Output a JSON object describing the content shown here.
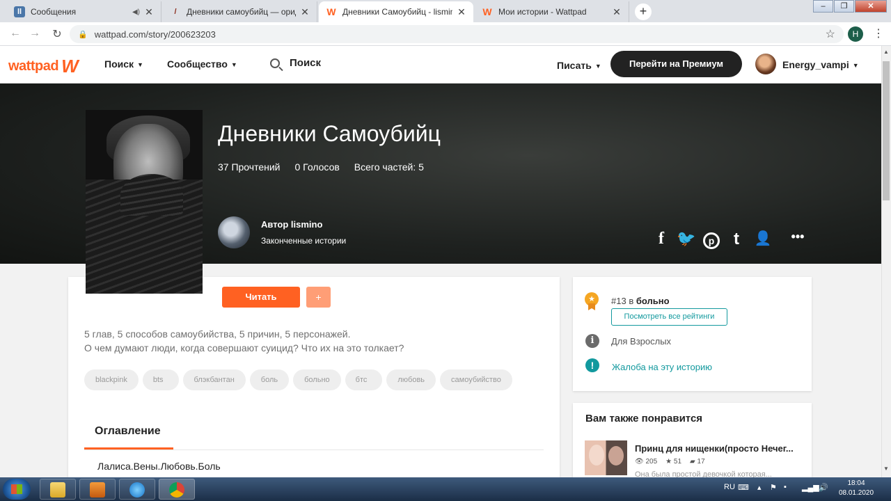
{
  "browser": {
    "tabs": [
      {
        "title": "Сообщения",
        "favicon": "messages-icon",
        "sound": false
      },
      {
        "title": "Дневники самоубийц — ориджин",
        "favicon": "feather-icon",
        "sound": false
      },
      {
        "title": "Дневники Самоубийц - lismino",
        "favicon": "wattpad-icon",
        "sound": false
      },
      {
        "title": "Мои истории - Wattpad",
        "favicon": "wattpad-icon",
        "sound": false
      }
    ],
    "url": "wattpad.com/story/200623203",
    "profile_initial": "H"
  },
  "header": {
    "logo": "wattpad",
    "nav": [
      "Поиск",
      "Сообщество"
    ],
    "search_label": "Поиск",
    "write_label": "Писать",
    "premium_label": "Перейти на Премиум",
    "username": "Energy_vampi"
  },
  "story": {
    "title": "Дневники Самоубийц",
    "reads": "37 Прочтений",
    "votes": "0 Голосов",
    "parts": "Всего частей: 5",
    "author_label": "Автор lismino",
    "author_sub": "Законченные истории",
    "read_button": "Читать",
    "plus_button": "+",
    "description": [
      "5 глав, 5 способов самоубийства, 5 причин, 5 персонажей.",
      "О чем думают люди, когда совершают суицид? Что их на это толкает?"
    ],
    "tags": [
      "blackpink",
      "bts",
      "блэкбантан",
      "боль",
      "больно",
      "бтс",
      "любовь",
      "самоубийство"
    ],
    "toc_title": "Оглавление",
    "toc_items": [
      "Лалиса.Вены.Любовь.Боль"
    ]
  },
  "social": [
    "f",
    "t",
    "p",
    "t",
    "u",
    "•••"
  ],
  "sidebar": {
    "rank_number": "#13",
    "rank_suffix": " в ",
    "rank_category": "больно",
    "rankings_button": "Посмотреть все рейтинги",
    "adult": "Для Взрослых",
    "report": "Жалоба на эту историю",
    "also_like": "Вам также понравится",
    "rec_title": "Принц для нищенки(просто Нечег...",
    "rec_views": "205",
    "rec_votes": "51",
    "rec_comments": "17",
    "rec_excerpt": "Она была простой девочкой которая..."
  },
  "taskbar": {
    "lang": "RU",
    "time": "18:04",
    "date": "08.01.2020"
  },
  "colors": {
    "accent": "#ff6122",
    "teal": "#12999e",
    "dark": "#222222"
  }
}
